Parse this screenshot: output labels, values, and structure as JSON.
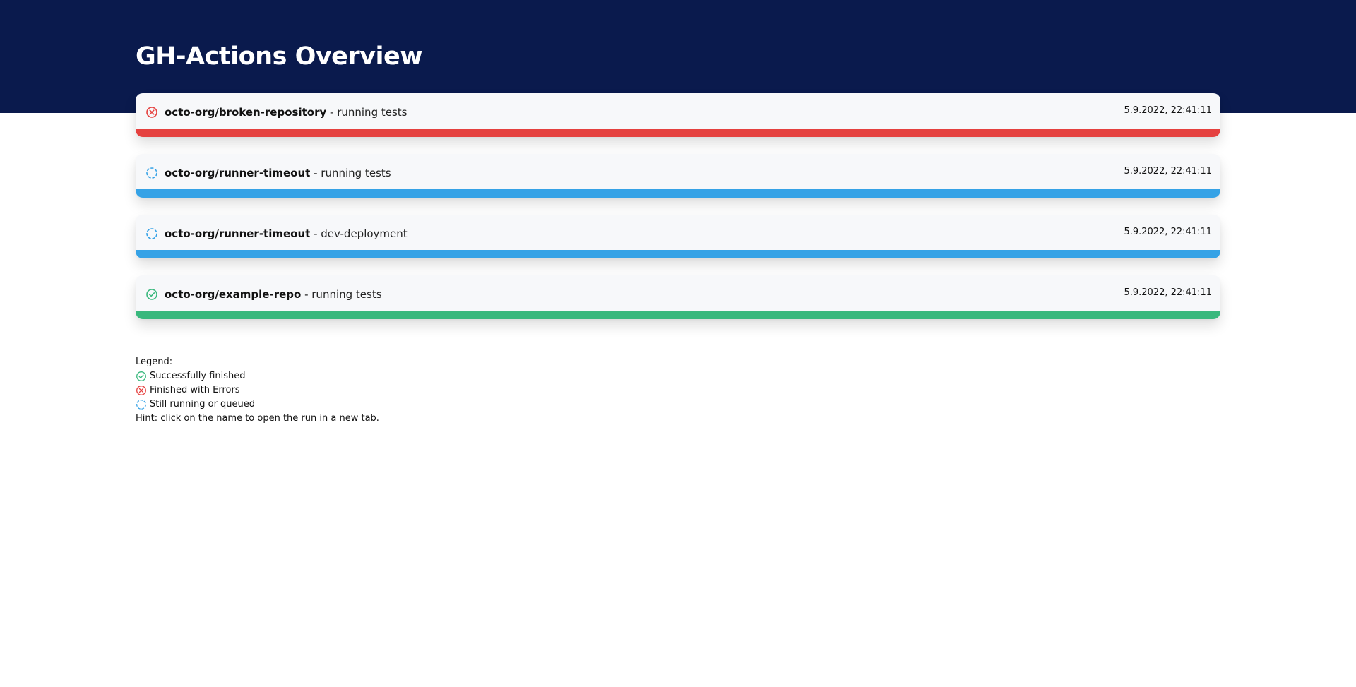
{
  "page": {
    "title": "GH-Actions Overview"
  },
  "colors": {
    "header_bg": "#0a1a4d",
    "error": "#e5413f",
    "running": "#35a2e6",
    "success": "#39b87d"
  },
  "runs": [
    {
      "status": "error",
      "status_icon": "error-circle-icon",
      "repo": "octo-org/broken-repository",
      "separator": " - ",
      "workflow": "running tests",
      "time": "5.9.2022, 22:41:11"
    },
    {
      "status": "running",
      "status_icon": "spinner-icon",
      "repo": "octo-org/runner-timeout",
      "separator": " - ",
      "workflow": "running tests",
      "time": "5.9.2022, 22:41:11"
    },
    {
      "status": "running",
      "status_icon": "spinner-icon",
      "repo": "octo-org/runner-timeout",
      "separator": " - ",
      "workflow": "dev-deployment",
      "time": "5.9.2022, 22:41:11"
    },
    {
      "status": "success",
      "status_icon": "check-circle-icon",
      "repo": "octo-org/example-repo",
      "separator": " - ",
      "workflow": "running tests",
      "time": "5.9.2022, 22:41:11"
    }
  ],
  "legend": {
    "heading": "Legend:",
    "items": [
      {
        "icon": "check-circle-icon",
        "label": "Successfully finished"
      },
      {
        "icon": "error-circle-icon",
        "label": "Finished with Errors"
      },
      {
        "icon": "spinner-icon",
        "label": "Still running or queued"
      }
    ],
    "hint": "Hint: click on the name to open the run in a new tab."
  }
}
